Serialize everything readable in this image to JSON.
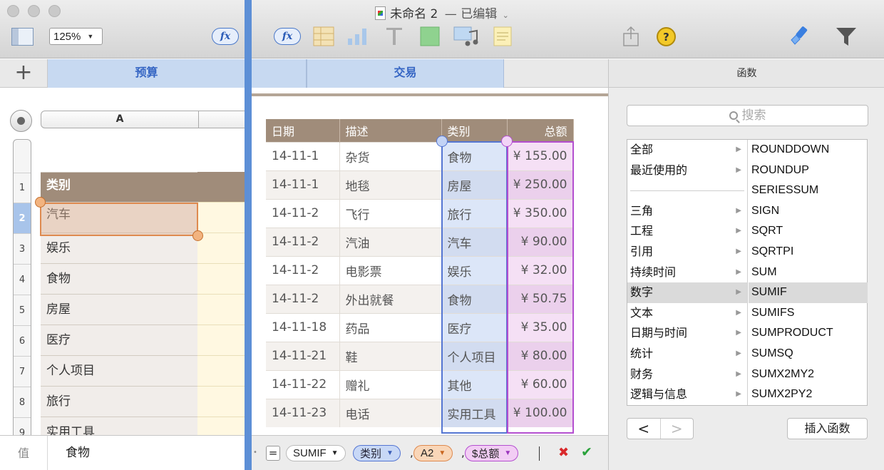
{
  "window": {
    "title": "未命名 2",
    "status": "— 已编辑",
    "zoom": "125%"
  },
  "toolbar": {
    "fx_label": "fx",
    "icons": [
      "sidebar-icon",
      "table-icon",
      "chart-icon",
      "text-icon",
      "shape-icon",
      "media-icon",
      "comment-icon",
      "share-icon",
      "tips-icon",
      "format-brush-icon",
      "filter-icon"
    ],
    "tips_label": "?"
  },
  "tabs": {
    "add": "+",
    "budget": "预算",
    "transactions": "交易"
  },
  "left_sheet": {
    "col_header": "A",
    "row_numbers": [
      "1",
      "2",
      "3",
      "4",
      "5",
      "6",
      "7",
      "8",
      "9"
    ],
    "header_cell": "类别",
    "categories": [
      "汽车",
      "娱乐",
      "食物",
      "房屋",
      "医疗",
      "个人项目",
      "旅行",
      "实用工具"
    ]
  },
  "transactions": {
    "headers": [
      "日期",
      "描述",
      "类别",
      "总额"
    ],
    "rows": [
      [
        "14-11-1",
        "杂货",
        "食物",
        "¥ 155.00"
      ],
      [
        "14-11-1",
        "地毯",
        "房屋",
        "¥ 250.00"
      ],
      [
        "14-11-2",
        "飞行",
        "旅行",
        "¥ 350.00"
      ],
      [
        "14-11-2",
        "汽油",
        "汽车",
        "¥ 90.00"
      ],
      [
        "14-11-2",
        "电影票",
        "娱乐",
        "¥ 32.00"
      ],
      [
        "14-11-2",
        "外出就餐",
        "食物",
        "¥ 50.75"
      ],
      [
        "14-11-18",
        "药品",
        "医疗",
        "¥ 35.00"
      ],
      [
        "14-11-21",
        "鞋",
        "个人项目",
        "¥ 80.00"
      ],
      [
        "14-11-22",
        "赠礼",
        "其他",
        "¥ 60.00"
      ],
      [
        "14-11-23",
        "电话",
        "实用工具",
        "¥ 100.00"
      ]
    ]
  },
  "formula": {
    "equals": "=",
    "function": "SUMIF",
    "arg1": "类别",
    "arg2": "A2",
    "arg3": "$总额",
    "comma": ",",
    "cancel": "✖",
    "accept": "✔"
  },
  "value_bar": {
    "label": "值",
    "value": "食物"
  },
  "functions_panel": {
    "title": "函数",
    "search_placeholder": "搜索",
    "categories": [
      "全部",
      "最近使用的",
      "",
      "三角",
      "工程",
      "引用",
      "持续时间",
      "数字",
      "文本",
      "日期与时间",
      "统计",
      "财务",
      "逻辑与信息"
    ],
    "selected_category": "数字",
    "functions": [
      "ROUNDDOWN",
      "ROUNDUP",
      "SERIESSUM",
      "SIGN",
      "SQRT",
      "SQRTPI",
      "SUM",
      "SUMIF",
      "SUMIFS",
      "SUMPRODUCT",
      "SUMSQ",
      "SUMX2MY2",
      "SUMX2PY2"
    ],
    "selected_function": "SUMIF",
    "back": "<",
    "forward": ">",
    "insert_label": "插入函数"
  },
  "colors": {
    "accent_blue": "#5d8fd6",
    "header_brown": "#a08c7a",
    "category_blue": "#dce6f8",
    "amount_pink": "#f5e0f5",
    "selection_orange": "#de8a4f"
  }
}
